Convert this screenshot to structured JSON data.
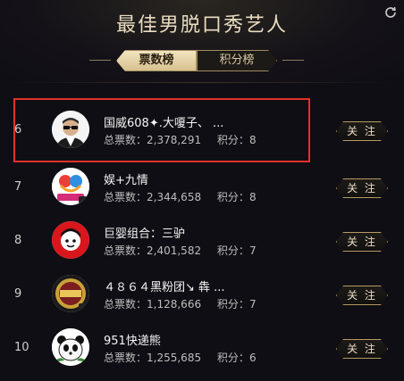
{
  "header": {
    "title": "最佳男脱口秀艺人",
    "tabs": [
      {
        "label": "票数榜",
        "active": true
      },
      {
        "label": "积分榜",
        "active": false
      }
    ]
  },
  "rows": [
    {
      "rank": "6",
      "name": "国威608✦.大嗄子、 ...",
      "votes_label": "总票数：",
      "votes": "2,378,291",
      "score_label": "积分：",
      "score": "8",
      "follow": "关 注",
      "avatar_icon": "avatar-man-sunglasses"
    },
    {
      "rank": "7",
      "name": "娱+九情",
      "votes_label": "总票数：",
      "votes": "2,344,658",
      "score_label": "积分：",
      "score": "8",
      "follow": "关 注",
      "avatar_icon": "avatar-logo-colorful"
    },
    {
      "rank": "8",
      "name": "巨婴组合：三驴",
      "votes_label": "总票数：",
      "votes": "2,401,582",
      "score_label": "积分：",
      "score": "7",
      "follow": "关 注",
      "avatar_icon": "avatar-red-cartoon"
    },
    {
      "rank": "9",
      "name": "４８６４黑粉团↘ 犇 ...",
      "votes_label": "总票数：",
      "votes": "1,128,666",
      "score_label": "积分：",
      "score": "7",
      "follow": "关 注",
      "avatar_icon": "avatar-gold-badge"
    },
    {
      "rank": "10",
      "name": "951快递熊",
      "votes_label": "总票数：",
      "votes": "1,255,685",
      "score_label": "积分：",
      "score": "6",
      "follow": "关 注",
      "avatar_icon": "avatar-panda"
    }
  ],
  "colors": {
    "accent_gold": "#b59a62",
    "highlight": "#e0322c",
    "background": "#0f0e14"
  }
}
